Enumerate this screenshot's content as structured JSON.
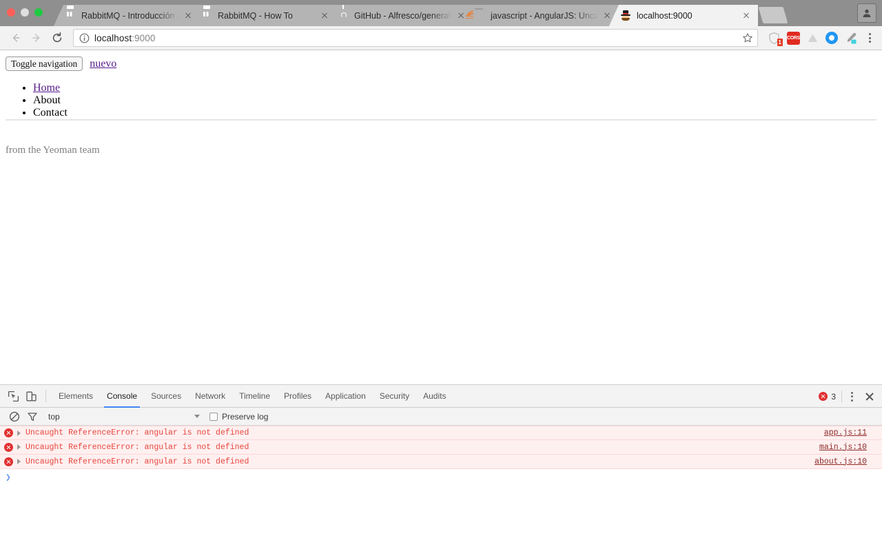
{
  "browser": {
    "tabs": [
      {
        "title": "RabbitMQ - Introducción a Ra",
        "favicon": "rabbitmq-icon",
        "active": false
      },
      {
        "title": "RabbitMQ - How To",
        "favicon": "rabbitmq-icon",
        "active": false
      },
      {
        "title": "GitHub - Alfresco/generator-n",
        "favicon": "github-icon",
        "active": false
      },
      {
        "title": "javascript - AngularJS: Uncau",
        "favicon": "stackoverflow-icon",
        "active": false
      },
      {
        "title": "localhost:9000",
        "favicon": "yeoman-icon",
        "active": true
      }
    ],
    "new_tab_label": "New Tab",
    "profile_label": "Profile",
    "toolbar": {
      "back_label": "Back",
      "forward_label": "Forward",
      "reload_label": "Reload",
      "url_prefix": "localhost",
      "url_suffix": ":9000",
      "url_full": "localhost:9000",
      "info_label": "Site information",
      "bookmark_label": "Bookmark this page",
      "menu_label": "Customize and control Chrome",
      "extensions": [
        {
          "name": "adblock-shield-icon",
          "badge": "1"
        },
        {
          "name": "cors-toggle-icon",
          "label": "CORS"
        },
        {
          "name": "drive-icon",
          "badge": ""
        },
        {
          "name": "blue-circle-extension-icon",
          "badge": ""
        },
        {
          "name": "eyedropper-icon",
          "badge": ""
        }
      ]
    }
  },
  "page": {
    "toggle_nav_label": "Toggle navigation",
    "brand_label": "nuevo",
    "nav_items": [
      {
        "label": "Home",
        "is_link": true
      },
      {
        "label": "About",
        "is_link": false
      },
      {
        "label": "Contact",
        "is_link": false
      }
    ],
    "footer_text": "from the Yeoman team"
  },
  "devtools": {
    "inspect_label": "Inspect element",
    "device_toolbar_label": "Toggle device toolbar",
    "tabs": [
      {
        "label": "Elements",
        "active": false
      },
      {
        "label": "Console",
        "active": true
      },
      {
        "label": "Sources",
        "active": false
      },
      {
        "label": "Network",
        "active": false
      },
      {
        "label": "Timeline",
        "active": false
      },
      {
        "label": "Profiles",
        "active": false
      },
      {
        "label": "Application",
        "active": false
      },
      {
        "label": "Security",
        "active": false
      },
      {
        "label": "Audits",
        "active": false
      }
    ],
    "error_count": "3",
    "more_label": "Customize and control DevTools",
    "close_label": "Close DevTools",
    "filterbar": {
      "clear_label": "Clear console",
      "filter_label": "Filter",
      "context": "top",
      "preserve_log_label": "Preserve log",
      "preserve_log_checked": false
    },
    "messages": [
      {
        "text": "Uncaught ReferenceError: angular is not defined",
        "source": "app.js:11",
        "level": "error"
      },
      {
        "text": "Uncaught ReferenceError: angular is not defined",
        "source": "main.js:10",
        "level": "error"
      },
      {
        "text": "Uncaught ReferenceError: angular is not defined",
        "source": "about.js:10",
        "level": "error"
      }
    ],
    "prompt_symbol": "❯"
  },
  "colors": {
    "accent_blue": "#4285f4",
    "error_red": "#e03131",
    "error_text": "#e8453c",
    "error_bg": "#fff0f0",
    "link_purple": "#551a8b",
    "rabbitmq_orange": "#ff6600"
  }
}
